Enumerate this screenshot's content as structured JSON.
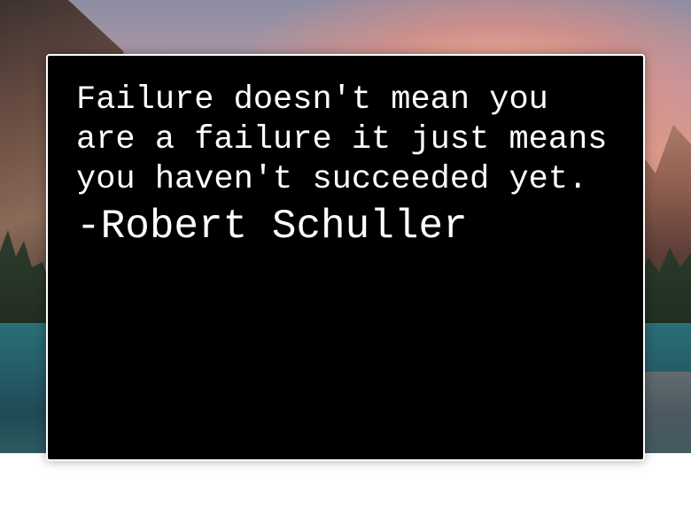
{
  "quote": {
    "text": "Failure doesn't mean you are a failure it just means you haven't succeeded yet.",
    "author": "-Robert Schuller"
  },
  "background": {
    "scene": "mountain-lake-landscape"
  },
  "colors": {
    "card_background": "#000000",
    "card_border": "#ffffff",
    "text": "#ffffff",
    "page_background": "#ffffff"
  }
}
